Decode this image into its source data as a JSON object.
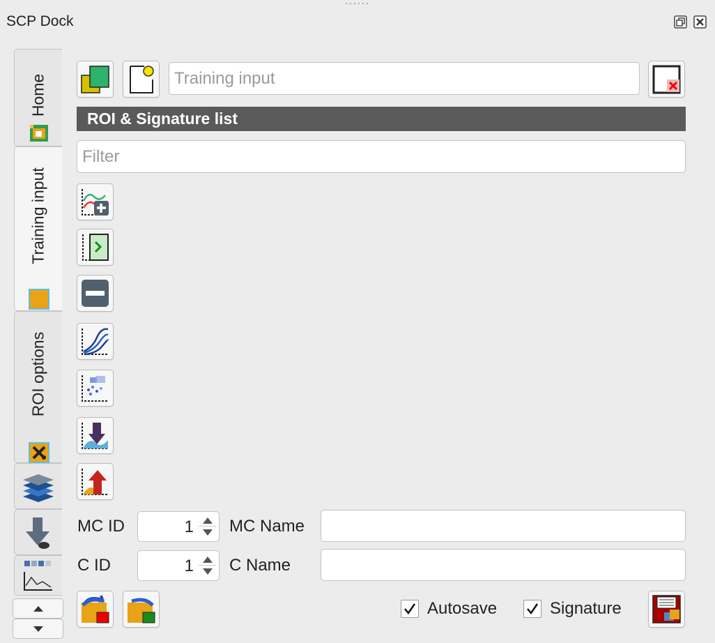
{
  "dock": {
    "title": "SCP Dock"
  },
  "tabs": [
    {
      "label": "Home",
      "icon": "home-icon"
    },
    {
      "label": "Training input",
      "icon": "training-input-icon"
    },
    {
      "label": "ROI options",
      "icon": "roi-options-icon"
    }
  ],
  "side_icon_tabs": [
    "layers-stack-icon",
    "download-raster-icon",
    "spectral-plot-icon"
  ],
  "training": {
    "input_placeholder": "Training input",
    "open_file_icon": "open-training-file-icon",
    "new_file_icon": "new-training-file-icon",
    "reset_icon": "reset-training-input-icon"
  },
  "roi_list": {
    "header": "ROI & Signature list",
    "filter_placeholder": "Filter"
  },
  "tool_icons": [
    "add-signature-icon",
    "merge-signatures-icon",
    "delete-item-icon",
    "spectral-signature-plot-icon",
    "scatter-plot-icon",
    "import-signatures-icon",
    "export-signatures-icon"
  ],
  "form": {
    "mc_id_label": "MC ID",
    "mc_id_value": "1",
    "mc_name_label": "MC Name",
    "mc_name_value": "",
    "c_id_label": "C ID",
    "c_id_value": "1",
    "c_name_label": "C Name",
    "c_name_value": ""
  },
  "bottom": {
    "undo_icon": "undo-save-icon",
    "redo_icon": "redo-save-icon",
    "autosave_label": "Autosave",
    "autosave_checked": true,
    "signature_label": "Signature",
    "signature_checked": true,
    "save_icon": "save-roi-icon"
  },
  "colors": {
    "header_bg": "#5a5a5a",
    "accent_orange": "#e8a317",
    "accent_green": "#2db36b"
  }
}
